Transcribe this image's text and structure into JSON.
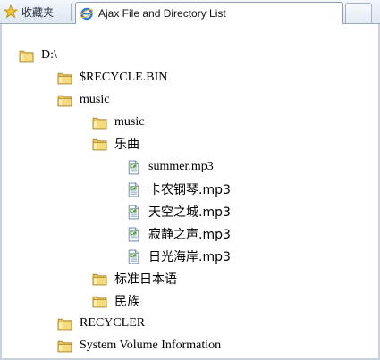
{
  "browser": {
    "favorites_label": "收藏夹",
    "tab_title": "Ajax File and Directory List"
  },
  "tree": {
    "root": "D:\\",
    "recycle_bin": "$RECYCLE.BIN",
    "music": "music",
    "music_sub": "music",
    "yuequ": "乐曲",
    "files": [
      "summer.mp3",
      "卡农钢琴.mp3",
      "天空之城.mp3",
      "寂静之声.mp3",
      "日光海岸.mp3"
    ],
    "biaozhun": "标准日本语",
    "minzu": "民族",
    "recycler": "RECYCLER",
    "svi": "System Volume Information"
  },
  "colors": {
    "folder": "#e7c35a",
    "folder_dark": "#b8922c",
    "tabbar": "#dfe7f2"
  },
  "icons": {
    "folder": "folder-icon",
    "file": "csharp-file-icon",
    "favorites": "star-icon",
    "browser_tab": "ie-icon"
  }
}
